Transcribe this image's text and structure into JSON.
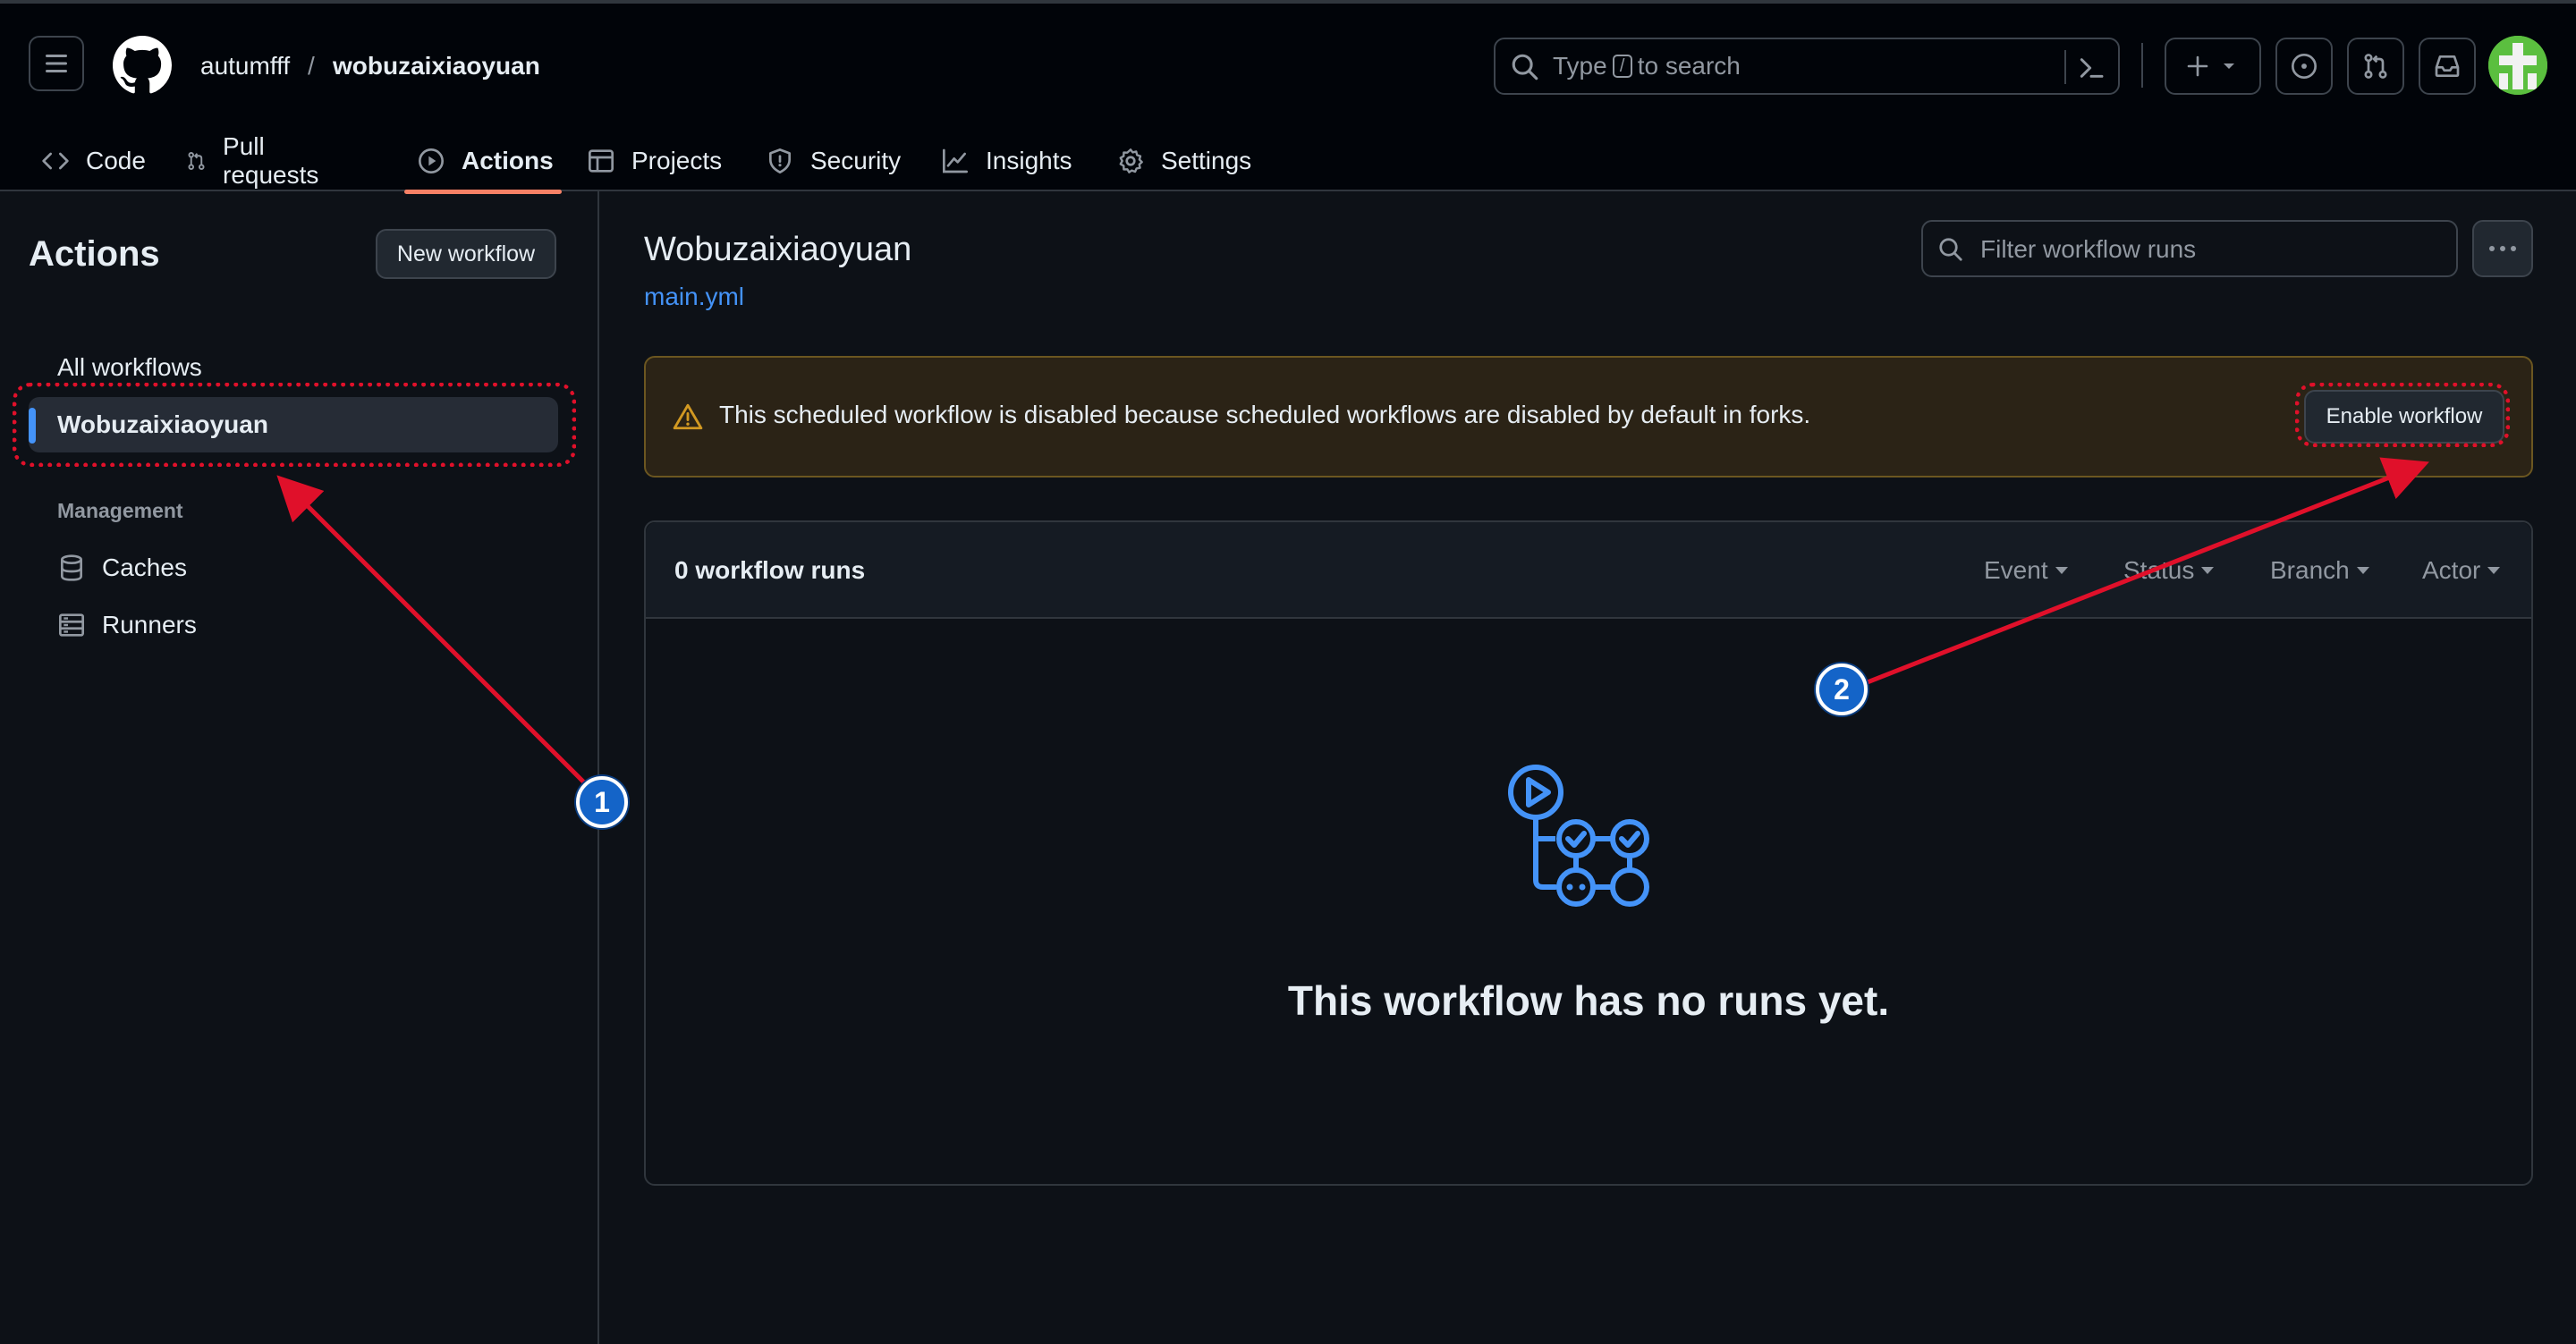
{
  "header": {
    "owner": "autumfff",
    "separator": "/",
    "repo": "wobuzaixiaoyuan",
    "search": {
      "prefix": "Type",
      "key": "/",
      "suffix": "to search"
    }
  },
  "repo_nav": {
    "tabs": [
      {
        "label": "Code",
        "icon": "code-icon"
      },
      {
        "label": "Pull requests",
        "icon": "git-pull-request-icon"
      },
      {
        "label": "Actions",
        "icon": "play-icon",
        "active": true
      },
      {
        "label": "Projects",
        "icon": "table-icon"
      },
      {
        "label": "Security",
        "icon": "shield-icon"
      },
      {
        "label": "Insights",
        "icon": "graph-icon"
      },
      {
        "label": "Settings",
        "icon": "gear-icon"
      }
    ]
  },
  "sidebar": {
    "title": "Actions",
    "new_workflow": "New workflow",
    "all_workflows": "All workflows",
    "active_workflow": "Wobuzaixiaoyuan",
    "management_heading": "Management",
    "management_items": [
      {
        "label": "Caches",
        "icon": "database-icon"
      },
      {
        "label": "Runners",
        "icon": "server-icon"
      }
    ]
  },
  "main": {
    "title": "Wobuzaixiaoyuan",
    "file_link": "main.yml",
    "filter_placeholder": "Filter workflow runs",
    "banner_text": "This scheduled workflow is disabled because scheduled workflows are disabled by default in forks.",
    "enable_button": "Enable workflow",
    "runs_count": "0 workflow runs",
    "filters": [
      "Event",
      "Status",
      "Branch",
      "Actor"
    ],
    "empty_text": "This workflow has no runs yet."
  },
  "annotations": {
    "badges": [
      "1",
      "2"
    ],
    "highlight_color": "#e0102a",
    "badge_color": "#1464c8"
  },
  "colors": {
    "page_bg": "#0d1117",
    "header_bg": "#010409",
    "link": "#4493f8",
    "tab_underline": "#f78166",
    "warning_bg": "#2b2316",
    "warning_icon": "#d29922"
  }
}
